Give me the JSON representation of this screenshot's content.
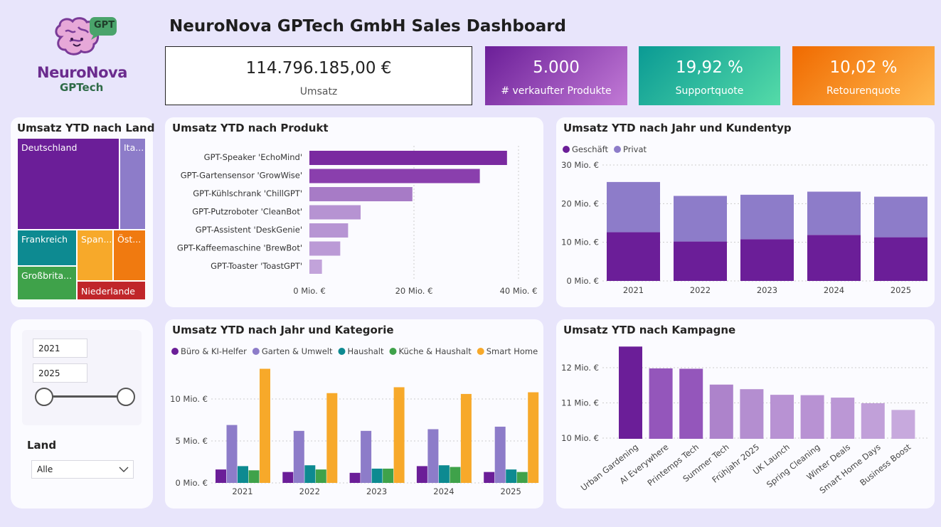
{
  "logo": {
    "name": "NeuroNova",
    "sub": "GPTech",
    "badge": "GPT"
  },
  "header": {
    "title": "NeuroNova GPTech GmbH Sales Dashboard"
  },
  "kpis": [
    {
      "value": "114.796.185,00 €",
      "label": "Umsatz"
    },
    {
      "value": "5.000",
      "label": "# verkaufter Produkte"
    },
    {
      "value": "19,92 %",
      "label": "Supportquote"
    },
    {
      "value": "10,02 %",
      "label": "Retourenquote"
    }
  ],
  "colors": {
    "purple": "#6b1e98",
    "lavender": "#8d7cc9",
    "teal": "#0d8a91",
    "green": "#3fa24a",
    "orange": "#f7a92a",
    "dark_orange": "#f07a10",
    "red": "#c0262a"
  },
  "treemap": {
    "title": "Umsatz YTD nach Land",
    "cells": [
      {
        "label": "Deutschland"
      },
      {
        "label": "Ita..."
      },
      {
        "label": "Frankreich"
      },
      {
        "label": "Span..."
      },
      {
        "label": "Öst..."
      },
      {
        "label": "Großbrita..."
      },
      {
        "label": "Niederlande"
      }
    ]
  },
  "slicer": {
    "from": "2021",
    "to": "2025",
    "land_label": "Land",
    "land_value": "Alle"
  },
  "chart_data": [
    {
      "type": "bar",
      "title": "Umsatz YTD nach Produkt",
      "orientation": "horizontal",
      "categories": [
        "GPT-Speaker 'EchoMind'",
        "GPT-Gartensensor 'GrowWise'",
        "GPT-Kühlschrank 'ChillGPT'",
        "GPT-Putzroboter 'CleanBot'",
        "GPT-Assistent 'DeskGenie'",
        "GPT-Kaffeemaschine 'BrewBot'",
        "GPT-Toaster 'ToastGPT'"
      ],
      "values": [
        37.8,
        32.6,
        19.7,
        9.8,
        7.4,
        5.9,
        2.4
      ],
      "unit": "Mio. €",
      "xticks": [
        "0 Mio. €",
        "20 Mio. €",
        "40 Mio. €"
      ],
      "xlim": [
        0,
        40
      ],
      "colors": [
        "#7a2aa0",
        "#8a3fad",
        "#a77bc6",
        "#b693d2",
        "#b795d3",
        "#bb9ad6",
        "#c2a3da"
      ]
    },
    {
      "type": "bar",
      "title": "Umsatz YTD nach Jahr und Kundentyp",
      "stacked": true,
      "categories": [
        "2021",
        "2022",
        "2023",
        "2024",
        "2025"
      ],
      "series": [
        {
          "name": "Geschäft",
          "values": [
            12.6,
            10.2,
            10.8,
            11.9,
            11.3
          ],
          "color": "#6b1e98"
        },
        {
          "name": "Privat",
          "values": [
            13.0,
            11.8,
            11.5,
            11.2,
            10.5
          ],
          "color": "#8d7cc9"
        }
      ],
      "yticks": [
        "0 Mio. €",
        "10 Mio. €",
        "20 Mio. €",
        "30 Mio. €"
      ],
      "ylim": [
        0,
        30
      ],
      "legend": "top-left"
    },
    {
      "type": "bar",
      "title": "Umsatz YTD nach Jahr und Kategorie",
      "categories": [
        "2021",
        "2022",
        "2023",
        "2024",
        "2025"
      ],
      "series": [
        {
          "name": "Büro & KI-Helfer",
          "values": [
            1.6,
            1.3,
            1.2,
            2.0,
            1.3
          ],
          "color": "#6b1e98"
        },
        {
          "name": "Garten & Umwelt",
          "values": [
            6.9,
            6.2,
            6.2,
            6.4,
            6.7
          ],
          "color": "#8d7cc9"
        },
        {
          "name": "Haushalt",
          "values": [
            2.0,
            2.1,
            1.7,
            2.1,
            1.6
          ],
          "color": "#0d8a91"
        },
        {
          "name": "Küche & Haushalt",
          "values": [
            1.5,
            1.6,
            1.7,
            1.9,
            1.3
          ],
          "color": "#3fa24a"
        },
        {
          "name": "Smart Home",
          "values": [
            13.6,
            10.7,
            11.4,
            10.6,
            10.8
          ],
          "color": "#f7a92a"
        }
      ],
      "yticks": [
        "0 Mio. €",
        "5 Mio. €",
        "10 Mio. €"
      ],
      "ylim": [
        0,
        14
      ],
      "legend": "top-left"
    },
    {
      "type": "bar",
      "title": "Umsatz YTD nach Kampagne",
      "categories": [
        "Urban Gardening",
        "AI Everywhere",
        "Printemps Tech",
        "Summer Tech",
        "Frühjahr 2025",
        "UK Launch",
        "Spring Cleaning",
        "Winter Deals",
        "Smart Home Days",
        "Business Boost"
      ],
      "values": [
        12.6,
        11.98,
        11.97,
        11.52,
        11.39,
        11.23,
        11.22,
        11.15,
        10.99,
        10.8
      ],
      "yticks": [
        "10 Mio. €",
        "11 Mio. €",
        "12 Mio. €"
      ],
      "ylim": [
        9.98,
        12.8
      ],
      "colors": [
        "#6b1e98",
        "#9456bb",
        "#9456bb",
        "#ad83cb",
        "#b48ed0",
        "#b892d3",
        "#b892d3",
        "#bb97d5",
        "#c1a0d9",
        "#c7a9dd"
      ]
    }
  ]
}
